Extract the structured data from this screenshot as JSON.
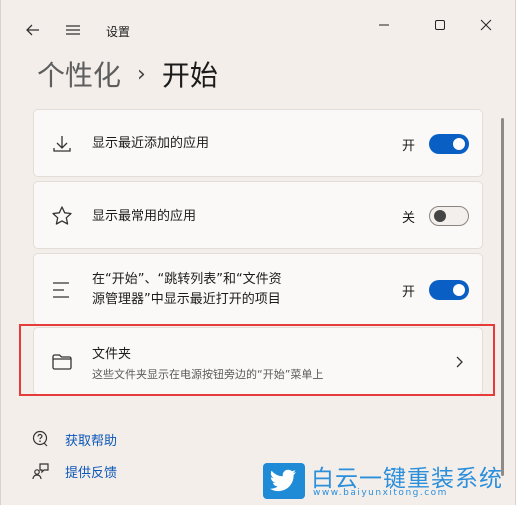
{
  "window": {
    "title": "设置",
    "breadcrumb_parent": "个性化",
    "breadcrumb_separator": "›",
    "breadcrumb_current": "开始"
  },
  "settings": [
    {
      "label": "显示最近添加的应用",
      "state": "开",
      "on": true,
      "icon": "download-icon"
    },
    {
      "label": "显示最常用的应用",
      "state": "关",
      "on": false,
      "icon": "star-icon"
    },
    {
      "label_line1": "在“开始”、“跳转列表”和“文件资",
      "label_line2": "源管理器”中显示最近打开的项目",
      "state": "开",
      "on": true,
      "icon": "list-icon"
    },
    {
      "label": "文件夹",
      "sub": "这些文件夹显示在电源按钮旁边的“开始”菜单上",
      "icon": "folder-icon"
    }
  ],
  "links": {
    "help": "获取帮助",
    "feedback": "提供反馈"
  },
  "watermark": {
    "brand": "白云一键重装系统",
    "url": "www.baiyunxitong.com"
  },
  "colors": {
    "accent": "#0a5fc4",
    "highlight": "#e53b3b",
    "link": "#0b57b8"
  }
}
